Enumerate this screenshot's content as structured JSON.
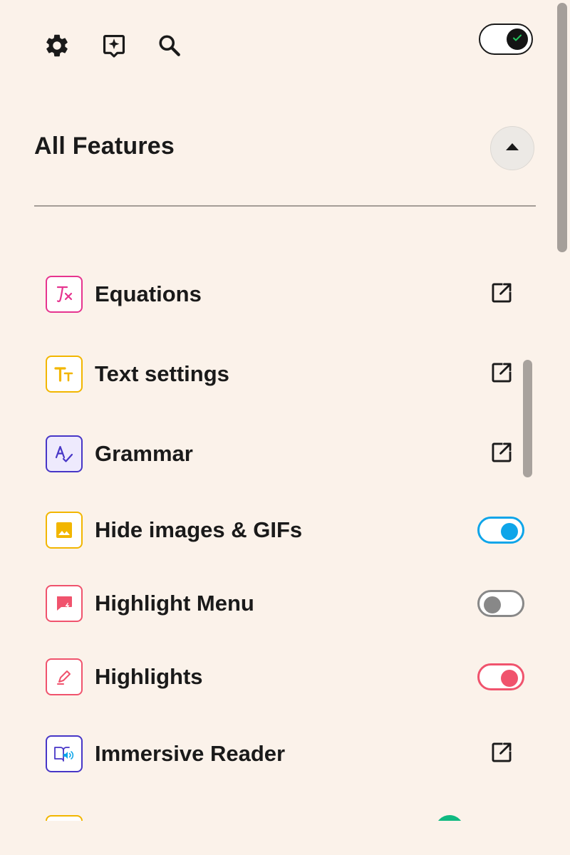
{
  "toolbar": {
    "icons": [
      "gear-icon",
      "sparkle-icon",
      "search-icon"
    ],
    "master_toggle": {
      "state": "on",
      "check_color": "#22c55e"
    }
  },
  "section": {
    "title": "All Features",
    "collapse_icon": "caret-up-icon"
  },
  "features": [
    {
      "label": "Equations",
      "icon": "equation-icon",
      "color": "#e6348f",
      "bg": "#ffffff",
      "control": "external-link"
    },
    {
      "label": "Text settings",
      "icon": "text-size-icon",
      "color": "#f2b600",
      "bg": "#ffffff",
      "control": "external-link"
    },
    {
      "label": "Grammar",
      "icon": "grammar-check-icon",
      "color": "#4736c7",
      "bg": "#eeeafd",
      "control": "external-link"
    },
    {
      "label": "Hide images & GIFs",
      "icon": "image-icon",
      "color": "#f2b600",
      "bg": "#ffffff",
      "control": "toggle",
      "state": "on",
      "toggle_color": "#0ea5e9"
    },
    {
      "label": "Highlight Menu",
      "icon": "highlight-menu-icon",
      "color": "#f0536d",
      "bg": "#ffffff",
      "control": "toggle",
      "state": "off",
      "toggle_color": "#888888"
    },
    {
      "label": "Highlights",
      "icon": "highlighter-icon",
      "color": "#f0536d",
      "bg": "#ffffff",
      "control": "toggle",
      "state": "on",
      "toggle_color": "#f0536d"
    },
    {
      "label": "Immersive Reader",
      "icon": "immersive-reader-icon",
      "color": "#4736c7",
      "bg": "#ffffff",
      "control": "external-link"
    }
  ]
}
